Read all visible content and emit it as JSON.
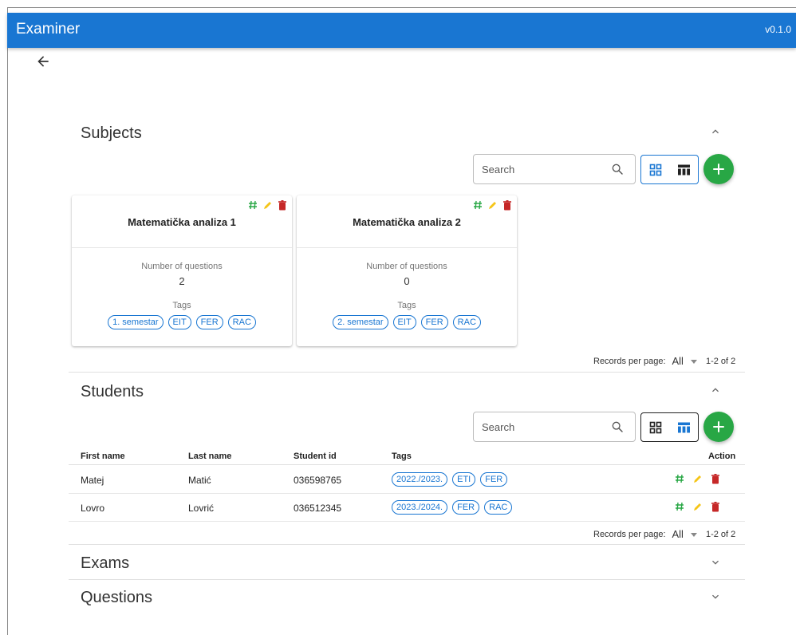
{
  "app": {
    "title": "Examiner",
    "version": "v0.1.0"
  },
  "icons": {
    "back": "arrow-left-icon",
    "expand_up": "chevron-up-icon",
    "expand_down": "chevron-down-icon",
    "search": "search-icon",
    "grid": "grid-view-icon",
    "table": "table-view-icon",
    "add": "plus-icon",
    "tags": "hash-icon",
    "edit": "pencil-icon",
    "delete": "trash-icon"
  },
  "colors": {
    "appbar": "#1976d2",
    "accent": "#1976d2",
    "add_button": "#28a745",
    "hash": "#28a745",
    "edit": "#f5c518",
    "delete": "#c62828"
  },
  "subjects": {
    "title": "Subjects",
    "search_placeholder": "Search",
    "cards": [
      {
        "name": "Matematička analiza 1",
        "questions_label": "Number of questions",
        "questions": "2",
        "tags_label": "Tags",
        "tags": [
          "1. semestar",
          "EIT",
          "FER",
          "RAC"
        ]
      },
      {
        "name": "Matematička analiza 2",
        "questions_label": "Number of questions",
        "questions": "0",
        "tags_label": "Tags",
        "tags": [
          "2. semestar",
          "EIT",
          "FER",
          "RAC"
        ]
      }
    ],
    "pager": {
      "label": "Records per page:",
      "value": "All",
      "count": "1-2 of 2"
    }
  },
  "students": {
    "title": "Students",
    "search_placeholder": "Search",
    "columns": [
      "First name",
      "Last name",
      "Student id",
      "Tags",
      "Action"
    ],
    "rows": [
      {
        "first": "Matej",
        "last": "Matić",
        "id": "036598765",
        "tags": [
          "2022./2023.",
          "ETI",
          "FER"
        ]
      },
      {
        "first": "Lovro",
        "last": "Lovrić",
        "id": "036512345",
        "tags": [
          "2023./2024.",
          "FER",
          "RAC"
        ]
      }
    ],
    "pager": {
      "label": "Records per page:",
      "value": "All",
      "count": "1-2 of 2"
    }
  },
  "exams": {
    "title": "Exams"
  },
  "questions": {
    "title": "Questions"
  }
}
